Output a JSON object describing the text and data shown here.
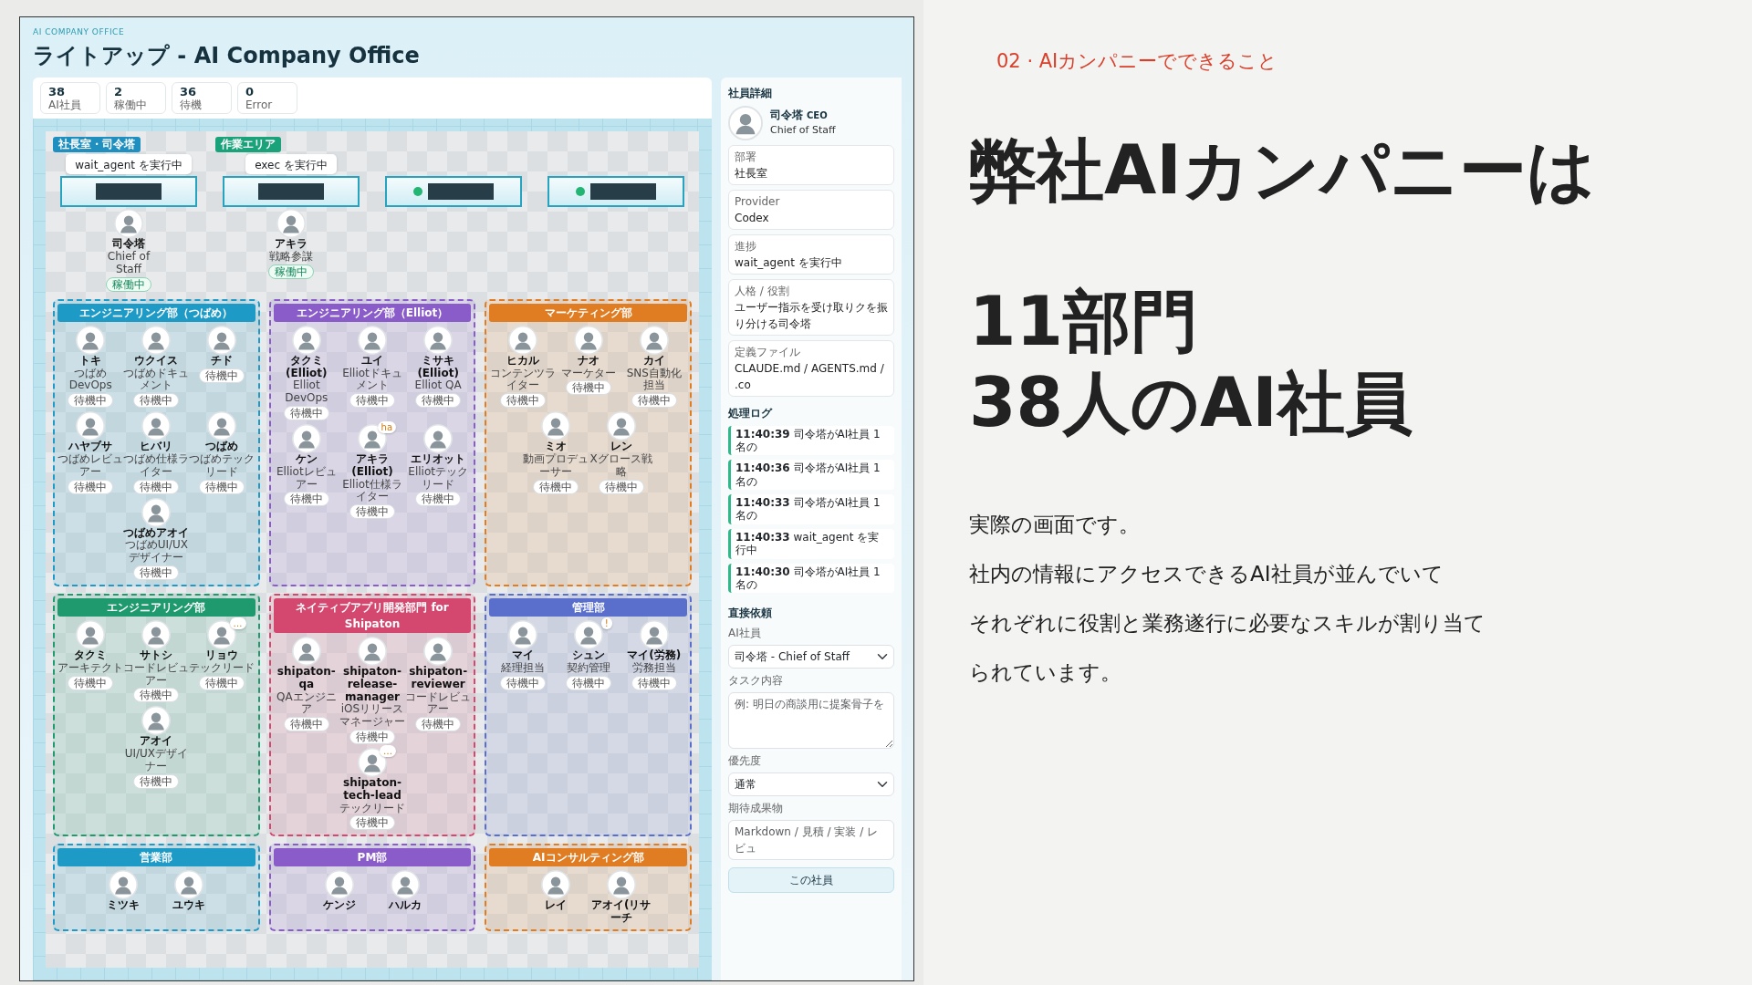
{
  "slide": {
    "eyebrow": "02 · AIカンパニーでできること",
    "headline": [
      "弊社AIカンパニーは",
      "11部門",
      "38人のAI社員"
    ],
    "body": [
      "実際の画面です。",
      "社内の情報にアクセスできるAI社員が並んでいて",
      "それぞれに役割と業務遂行に必要なスキルが割り当て",
      "られています。"
    ]
  },
  "app": {
    "eyebrow": "AI COMPANY OFFICE",
    "title": "ライトアップ - AI Company Office",
    "stats": [
      {
        "value": "38",
        "label": "AI社員"
      },
      {
        "value": "2",
        "label": "稼働中"
      },
      {
        "value": "36",
        "label": "待機"
      },
      {
        "value": "0",
        "label": "Error"
      }
    ],
    "stations": [
      {
        "area_label": "社長室・司令塔",
        "color": "#1f8fbf",
        "bubble": "wait_agent を実行中",
        "lit": false,
        "member": {
          "name": "司令塔",
          "role": "Chief of Staff",
          "status": "稼働中",
          "active": true
        }
      },
      {
        "area_label": "作業エリア",
        "color": "#1aa37a",
        "bubble": "exec を実行中",
        "lit": false,
        "member": {
          "name": "アキラ",
          "role": "戦略参謀",
          "status": "稼働中",
          "active": true
        }
      },
      {
        "lit": true
      },
      {
        "lit": true
      }
    ],
    "departments": [
      {
        "name": "エンジニアリング部（つばめ）",
        "color": "#1e9ac7",
        "members": [
          {
            "name": "トキ",
            "role": "つばめDevOps",
            "status": "待機中",
            "active": false
          },
          {
            "name": "ウクイス",
            "role": "つばめドキュメント",
            "status": "待機中",
            "active": false
          },
          {
            "name": "チド",
            "status": "待機中",
            "active": false
          },
          {
            "name": "ハヤブサ",
            "role": "つばめレビュアー",
            "status": "待機中",
            "active": false
          },
          {
            "name": "ヒバリ",
            "role": "つばめ仕様ライター",
            "status": "待機中",
            "active": false
          },
          {
            "name": "つばめ",
            "role": "つばめテックリード",
            "status": "待機中",
            "active": false
          },
          {
            "name": "つばめアオイ",
            "role": "つばめUI/UXデザイナー",
            "status": "待機中",
            "active": false
          }
        ]
      },
      {
        "name": "エンジニアリング部（Elliot）",
        "color": "#8a5cc9",
        "members": [
          {
            "name": "タクミ(Elliot)",
            "role": "Elliot DevOps",
            "status": "待機中",
            "active": false
          },
          {
            "name": "ユイ",
            "role": "Elliotドキュメント",
            "status": "待機中",
            "active": false
          },
          {
            "name": "ミサキ(Elliot)",
            "role": "Elliot QA",
            "status": "待機中",
            "active": false
          },
          {
            "name": "ケン",
            "role": "Elliotレビュアー",
            "status": "待機中",
            "active": false
          },
          {
            "name": "アキラ(Elliot)",
            "role": "Elliot仕様ライター",
            "status": "待機中",
            "active": false,
            "badge": "ha"
          },
          {
            "name": "エリオット",
            "role": "Elliotテックリード",
            "status": "待機中",
            "active": false
          }
        ]
      },
      {
        "name": "マーケティング部",
        "color": "#e07d22",
        "members": [
          {
            "name": "ヒカル",
            "role": "コンテンツライター",
            "status": "待機中",
            "active": false
          },
          {
            "name": "ナオ",
            "role": "マーケター",
            "status": "待機中",
            "active": false
          },
          {
            "name": "カイ",
            "role": "SNS自動化担当",
            "status": "待機中",
            "active": false
          },
          {
            "name": "ミオ",
            "role": "動画プロデューサー",
            "status": "待機中",
            "active": false
          },
          {
            "name": "レン",
            "role": "Xグロース戦略",
            "status": "待機中",
            "active": false
          }
        ]
      },
      {
        "name": "エンジニアリング部",
        "color": "#1f9a6e",
        "members": [
          {
            "name": "タクミ",
            "role": "アーキテクト",
            "status": "待機中",
            "active": false
          },
          {
            "name": "サトシ",
            "role": "コードレビュアー",
            "status": "待機中",
            "active": false
          },
          {
            "name": "リョウ",
            "role": "テックリード",
            "status": "待機中",
            "active": false,
            "badge": "…"
          },
          {
            "name": "アオイ",
            "role": "UI/UXデザイナー",
            "status": "待機中",
            "active": false
          }
        ]
      },
      {
        "name": "ネイティブアプリ開発部門 for Shipaton",
        "color": "#d4476f",
        "members": [
          {
            "name": "shipaton-qa",
            "role": "QAエンジニア",
            "status": "待機中",
            "active": false
          },
          {
            "name": "shipaton-release-manager",
            "role": "iOSリリースマネージャー",
            "status": "待機中",
            "active": false
          },
          {
            "name": "shipaton-reviewer",
            "role": "コードレビュアー",
            "status": "待機中",
            "active": false
          },
          {
            "name": "shipaton-tech-lead",
            "role": "テックリード",
            "status": "待機中",
            "active": false,
            "badge": "…"
          }
        ]
      },
      {
        "name": "管理部",
        "color": "#5a6fcc",
        "members": [
          {
            "name": "マイ",
            "role": "経理担当",
            "status": "待機中",
            "active": false
          },
          {
            "name": "シュン",
            "role": "契約管理",
            "status": "待機中",
            "active": false,
            "badge": "!"
          },
          {
            "name": "マイ(労務)",
            "role": "労務担当",
            "status": "待機中",
            "active": false
          }
        ]
      },
      {
        "name": "営業部",
        "color": "#1e9ac7",
        "members": [
          {
            "name": "ミツキ"
          },
          {
            "name": "ユウキ"
          }
        ]
      },
      {
        "name": "PM部",
        "color": "#8a5cc9",
        "members": [
          {
            "name": "ケンジ"
          },
          {
            "name": "ハルカ"
          }
        ]
      },
      {
        "name": "AIコンサルティング部",
        "color": "#e07d22",
        "members": [
          {
            "name": "レイ"
          },
          {
            "name": "アオイ(リサーチ"
          }
        ]
      }
    ],
    "detail": {
      "heading": "社員詳細",
      "name": "司令塔",
      "tag": "CEO",
      "subtitle": "Chief of Staff",
      "fields": [
        {
          "label": "部署",
          "value": "社長室"
        },
        {
          "label": "Provider",
          "value": "Codex"
        },
        {
          "label": "進捗",
          "value": "wait_agent を実行中"
        },
        {
          "label": "人格 / 役割",
          "value": "ユーザー指示を受け取りクを振り分ける司令塔"
        },
        {
          "label": "定義ファイル",
          "value": "CLAUDE.md / AGENTS.md / .co"
        }
      ],
      "log_heading": "処理ログ",
      "log": [
        {
          "time": "11:40:39",
          "text": "司令塔がAI社員 1名の"
        },
        {
          "time": "11:40:36",
          "text": "司令塔がAI社員 1名の"
        },
        {
          "time": "11:40:33",
          "text": "司令塔がAI社員 1名の"
        },
        {
          "time": "11:40:33",
          "text": "wait_agent を実行中"
        },
        {
          "time": "11:40:30",
          "text": "司令塔がAI社員 1名の"
        }
      ],
      "request": {
        "heading": "直接依頼",
        "member_label": "AI社員",
        "member_value": "司令塔 - Chief of Staff",
        "task_label": "タスク内容",
        "task_placeholder": "例: 明日の商談用に提案骨子を",
        "priority_label": "優先度",
        "priority_value": "通常",
        "output_label": "期待成果物",
        "output_placeholder": "Markdown / 見積 / 実装 / レビュ",
        "submit": "この社員"
      }
    }
  }
}
